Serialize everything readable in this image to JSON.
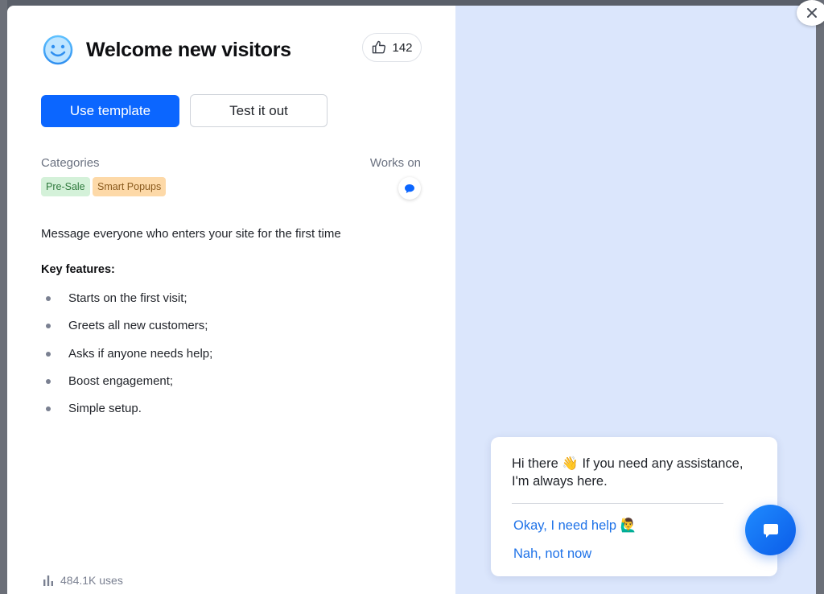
{
  "template": {
    "title": "Welcome new visitors",
    "likes": "142",
    "use_button": "Use template",
    "test_button": "Test it out",
    "categories_label": "Categories",
    "works_on_label": "Works on",
    "categories": [
      "Pre-Sale",
      "Smart Popups"
    ],
    "works_on_icon": "chat-bubble-icon",
    "description": "Message everyone who enters your site for the first time",
    "key_features_label": "Key features:",
    "features": [
      "Starts on the first visit;",
      "Greets all new customers;",
      "Asks if anyone needs help;",
      "Boost engagement;",
      "Simple setup."
    ],
    "uses": "484.1K uses"
  },
  "preview": {
    "message": "Hi there 👋 If you need any assistance, I'm always here.",
    "option_1": "Okay, I need help 🙋‍♂️",
    "option_2": "Nah, not now"
  },
  "colors": {
    "accent": "#0b66ff",
    "preview_bg": "#dbe6fc",
    "tag_green": "#d4f1d9",
    "tag_orange": "#fdd9a8",
    "link": "#1e72e8"
  }
}
